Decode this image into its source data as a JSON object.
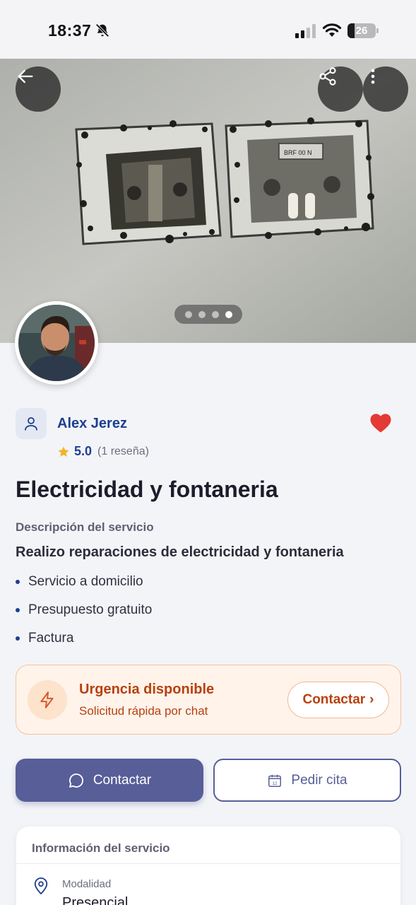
{
  "status_bar": {
    "time": "18:37",
    "battery_level": "26",
    "battery_fraction": 0.26
  },
  "hero": {
    "image_description_icon": "photo-icon",
    "page_count": 4,
    "active_page": 4,
    "icons": {
      "back": "arrow-left-icon",
      "share": "share-icon",
      "more": "more-vertical-icon"
    }
  },
  "provider": {
    "name": "Alex Jerez",
    "rating": "5.0",
    "reviews": "(1 reseña)",
    "favorite": true,
    "icons": {
      "person": "user-icon",
      "favorite": "heart-icon",
      "star": "star-icon"
    }
  },
  "service": {
    "title": "Electricidad y fontaneria",
    "description_label": "Descripción del servicio",
    "description": "Realizo reparaciones de electricidad y fontaneria",
    "features": [
      "Servicio a domicilio",
      "Presupuesto gratuito",
      "Factura"
    ]
  },
  "urgency": {
    "title": "Urgencia disponible",
    "subtitle": "Solicitud rápida por chat",
    "button_label": "Contactar",
    "button_chevron": "›"
  },
  "actions": {
    "contact_label": "Contactar",
    "appointment_label": "Pedir cita"
  },
  "info": {
    "title": "Información del servicio",
    "modality_label": "Modalidad",
    "modality_value": "Presencial"
  },
  "colors": {
    "brand_blue": "#1d3f8f",
    "primary_button": "#575e98",
    "urgency_orange": "#b7410e",
    "favorite_red": "#e53935"
  }
}
